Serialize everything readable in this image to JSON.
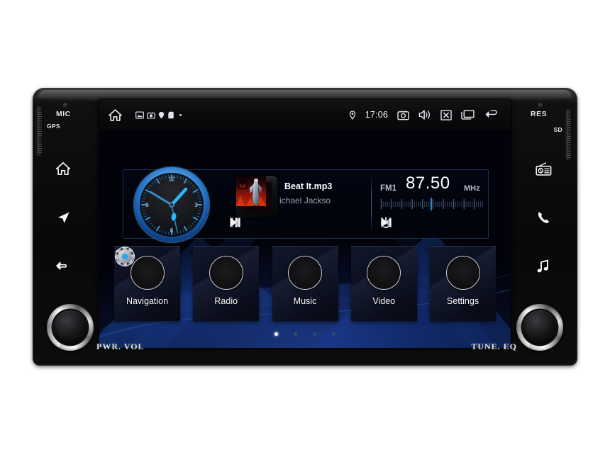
{
  "device": {
    "left_bezel": {
      "mic_label": "MIC",
      "gps_label": "GPS",
      "buttons": [
        {
          "name": "home",
          "icon": "home-icon"
        },
        {
          "name": "navigation",
          "icon": "navigation-arrow-icon"
        },
        {
          "name": "back",
          "icon": "back-arrow-icon"
        }
      ]
    },
    "right_bezel": {
      "reset_label": "RES",
      "sd_label": "SD",
      "buttons": [
        {
          "name": "radio",
          "icon": "radio-icon"
        },
        {
          "name": "phone",
          "icon": "phone-icon"
        },
        {
          "name": "music",
          "icon": "music-note-icon"
        }
      ]
    },
    "knobs": [
      {
        "name": "power-volume",
        "label": "PWR. VOL"
      },
      {
        "name": "tune-eq",
        "label": "TUNE. EQ"
      }
    ]
  },
  "status_bar": {
    "home_icon": "home-icon",
    "notifications": [
      "image-icon",
      "screenshot-icon",
      "location-pin-icon",
      "sd-card-icon"
    ],
    "location_icon": "location-pin-icon",
    "time": "17:06",
    "right_icons": [
      "camera-icon",
      "volume-icon",
      "close-box-icon",
      "recents-icon",
      "back-arrow-icon"
    ]
  },
  "widget": {
    "clock": {
      "numerals": [
        "12",
        "3",
        "6",
        "9"
      ],
      "hour_angle": 42,
      "minute_angle": 200,
      "second_angle": 155,
      "accent_color": "#29b6f6"
    },
    "media": {
      "title": "Beat It.mp3",
      "artist": "ichael Jackso",
      "album_art": "album-art-thriller",
      "controls": [
        {
          "name": "previous-track",
          "icon": "skip-previous-icon"
        },
        {
          "name": "play-pause",
          "icon": "pause-icon"
        },
        {
          "name": "next-track",
          "icon": "skip-next-icon"
        }
      ]
    },
    "radio": {
      "band": "FM1",
      "frequency": "87.50",
      "unit": "MHz",
      "controls": [
        {
          "name": "radio-previous",
          "icon": "skip-previous-icon"
        },
        {
          "name": "radio-power",
          "icon": "power-icon"
        },
        {
          "name": "radio-next",
          "icon": "skip-next-icon"
        }
      ]
    }
  },
  "apps": [
    {
      "label": "Navigation",
      "icon": "navigation-arrow-icon"
    },
    {
      "label": "Radio",
      "icon": "radio-icon"
    },
    {
      "label": "Music",
      "icon": "music-note-icon"
    },
    {
      "label": "Video",
      "icon": "film-reel-icon"
    },
    {
      "label": "Settings",
      "icon": "gear-icon"
    }
  ],
  "pager": {
    "total": 4,
    "active_index": 0
  }
}
